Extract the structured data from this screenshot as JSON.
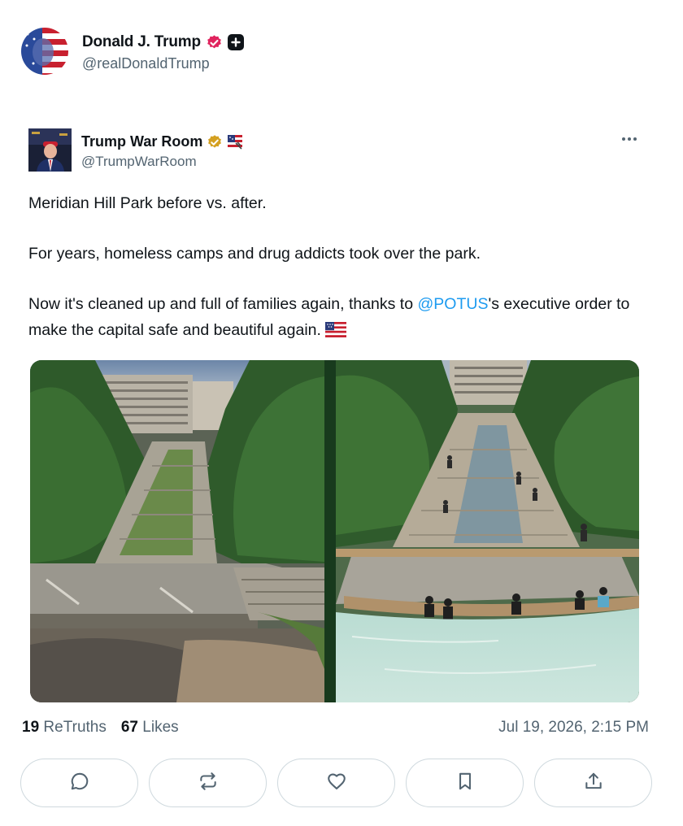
{
  "author": {
    "display_name": "Donald J. Trump",
    "handle": "@realDonaldTrump"
  },
  "quoted_post": {
    "display_name": "Trump War Room",
    "handle": "@TrumpWarRoom",
    "paragraph_1": "Meridian Hill Park before vs. after.",
    "paragraph_2": "For years, homeless camps and drug addicts took over the park.",
    "paragraph_3_before_mention": "Now it's cleaned up and full of families again, thanks to ",
    "mention": "@POTUS",
    "paragraph_3_after_mention": "'s executive order to make the capital safe and beautiful again."
  },
  "stats": {
    "retruths_count": "19",
    "retruths_label": "ReTruths",
    "likes_count": "67",
    "likes_label": "Likes",
    "timestamp": "Jul 19, 2026, 2:15 PM"
  },
  "icons": {
    "verified_main": "verified-badge-icon",
    "plus": "plus-icon",
    "verified_gold": "verified-gold-badge-icon",
    "flag": "us-flag-icon",
    "more": "more-dots-icon",
    "reply": "reply-icon",
    "retruth": "retruth-icon",
    "like": "heart-icon",
    "bookmark": "bookmark-icon",
    "share": "share-icon"
  },
  "colors": {
    "text": "#0f1419",
    "muted": "#536471",
    "link": "#1d9bf0",
    "verified_pink": "#e0245e",
    "verified_gold": "#d4a021",
    "border": "#cfd9de"
  }
}
